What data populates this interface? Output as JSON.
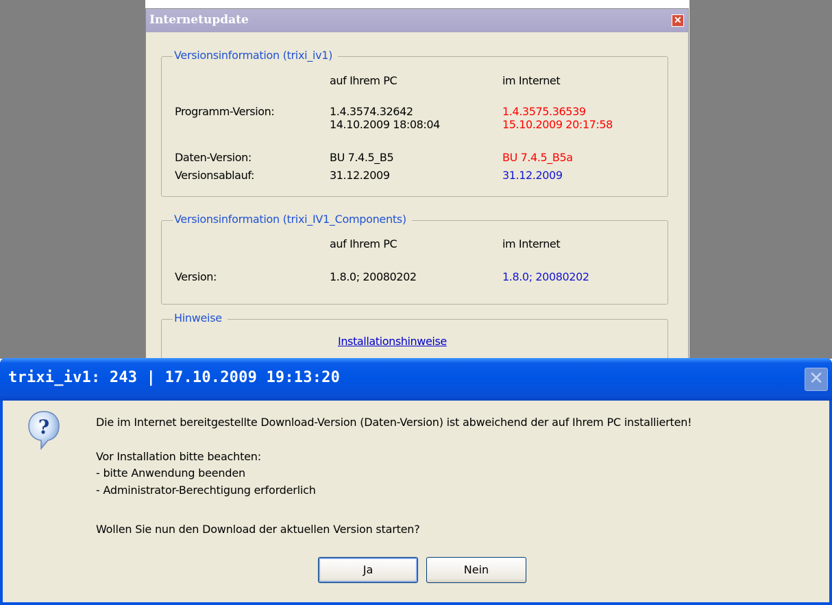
{
  "back_window": {
    "title": "Internetupdate",
    "close_glyph": "✕",
    "group1": {
      "legend": "Versionsinformation  (trixi_iv1)",
      "col_pc": "auf Ihrem PC",
      "col_internet": "im Internet",
      "rows": [
        {
          "label": "Programm-Version:",
          "pc": "1.4.3574.32642",
          "pc2": "14.10.2009 18:08:04",
          "internet": "1.4.3575.36539",
          "internet2": "15.10.2009 20:17:58"
        },
        {
          "label": "Daten-Version:",
          "pc": "BU 7.4.5_B5",
          "internet": "BU 7.4.5_B5a"
        },
        {
          "label": "Versionsablauf:",
          "pc": "31.12.2009",
          "internet": "31.12.2009"
        }
      ]
    },
    "group2": {
      "legend": "Versionsinformation  (trixi_IV1_Components)",
      "col_pc": "auf Ihrem PC",
      "col_internet": "im Internet",
      "row": {
        "label": "Version:",
        "pc": "1.8.0; 20080202",
        "internet": "1.8.0; 20080202"
      }
    },
    "group3": {
      "legend": "Hinweise",
      "link": "Installationshinweise"
    },
    "colors": {
      "red": "#ff0000",
      "blue": "#1515d0"
    }
  },
  "dialog": {
    "title": "trixi_iv1: 243 | 17.10.2009 19:13:20",
    "close_glyph": "✕",
    "icon": "question-icon",
    "lines": [
      "Die im Internet bereitgestellte Download-Version (Daten-Version) ist abweichend der auf Ihrem PC installierten!",
      "Vor Installation bitte beachten:",
      "- bitte Anwendung beenden",
      "- Administrator-Berechtigung erforderlich",
      "Wollen Sie nun den Download der aktuellen Version starten?"
    ],
    "buttons": {
      "yes": "Ja",
      "no": "Nein"
    },
    "colors": {
      "titlebar": "#0054e3",
      "face": "#ece9d8"
    }
  }
}
